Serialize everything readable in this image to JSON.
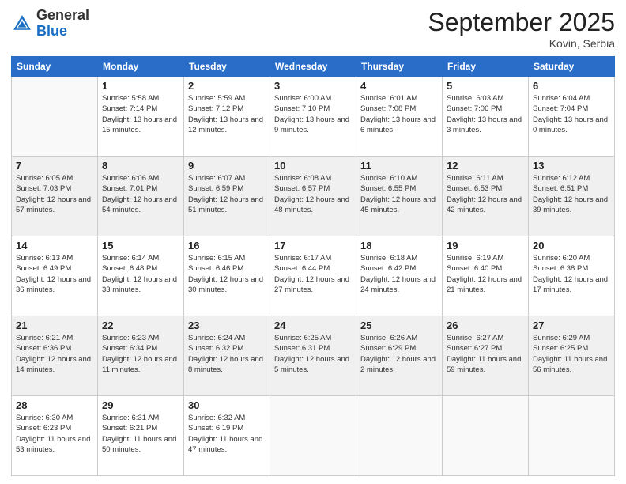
{
  "logo": {
    "general": "General",
    "blue": "Blue"
  },
  "header": {
    "month": "September 2025",
    "location": "Kovin, Serbia"
  },
  "weekdays": [
    "Sunday",
    "Monday",
    "Tuesday",
    "Wednesday",
    "Thursday",
    "Friday",
    "Saturday"
  ],
  "weeks": [
    [
      {
        "day": "",
        "sunrise": "",
        "sunset": "",
        "daylight": ""
      },
      {
        "day": "1",
        "sunrise": "Sunrise: 5:58 AM",
        "sunset": "Sunset: 7:14 PM",
        "daylight": "Daylight: 13 hours and 15 minutes."
      },
      {
        "day": "2",
        "sunrise": "Sunrise: 5:59 AM",
        "sunset": "Sunset: 7:12 PM",
        "daylight": "Daylight: 13 hours and 12 minutes."
      },
      {
        "day": "3",
        "sunrise": "Sunrise: 6:00 AM",
        "sunset": "Sunset: 7:10 PM",
        "daylight": "Daylight: 13 hours and 9 minutes."
      },
      {
        "day": "4",
        "sunrise": "Sunrise: 6:01 AM",
        "sunset": "Sunset: 7:08 PM",
        "daylight": "Daylight: 13 hours and 6 minutes."
      },
      {
        "day": "5",
        "sunrise": "Sunrise: 6:03 AM",
        "sunset": "Sunset: 7:06 PM",
        "daylight": "Daylight: 13 hours and 3 minutes."
      },
      {
        "day": "6",
        "sunrise": "Sunrise: 6:04 AM",
        "sunset": "Sunset: 7:04 PM",
        "daylight": "Daylight: 13 hours and 0 minutes."
      }
    ],
    [
      {
        "day": "7",
        "sunrise": "Sunrise: 6:05 AM",
        "sunset": "Sunset: 7:03 PM",
        "daylight": "Daylight: 12 hours and 57 minutes."
      },
      {
        "day": "8",
        "sunrise": "Sunrise: 6:06 AM",
        "sunset": "Sunset: 7:01 PM",
        "daylight": "Daylight: 12 hours and 54 minutes."
      },
      {
        "day": "9",
        "sunrise": "Sunrise: 6:07 AM",
        "sunset": "Sunset: 6:59 PM",
        "daylight": "Daylight: 12 hours and 51 minutes."
      },
      {
        "day": "10",
        "sunrise": "Sunrise: 6:08 AM",
        "sunset": "Sunset: 6:57 PM",
        "daylight": "Daylight: 12 hours and 48 minutes."
      },
      {
        "day": "11",
        "sunrise": "Sunrise: 6:10 AM",
        "sunset": "Sunset: 6:55 PM",
        "daylight": "Daylight: 12 hours and 45 minutes."
      },
      {
        "day": "12",
        "sunrise": "Sunrise: 6:11 AM",
        "sunset": "Sunset: 6:53 PM",
        "daylight": "Daylight: 12 hours and 42 minutes."
      },
      {
        "day": "13",
        "sunrise": "Sunrise: 6:12 AM",
        "sunset": "Sunset: 6:51 PM",
        "daylight": "Daylight: 12 hours and 39 minutes."
      }
    ],
    [
      {
        "day": "14",
        "sunrise": "Sunrise: 6:13 AM",
        "sunset": "Sunset: 6:49 PM",
        "daylight": "Daylight: 12 hours and 36 minutes."
      },
      {
        "day": "15",
        "sunrise": "Sunrise: 6:14 AM",
        "sunset": "Sunset: 6:48 PM",
        "daylight": "Daylight: 12 hours and 33 minutes."
      },
      {
        "day": "16",
        "sunrise": "Sunrise: 6:15 AM",
        "sunset": "Sunset: 6:46 PM",
        "daylight": "Daylight: 12 hours and 30 minutes."
      },
      {
        "day": "17",
        "sunrise": "Sunrise: 6:17 AM",
        "sunset": "Sunset: 6:44 PM",
        "daylight": "Daylight: 12 hours and 27 minutes."
      },
      {
        "day": "18",
        "sunrise": "Sunrise: 6:18 AM",
        "sunset": "Sunset: 6:42 PM",
        "daylight": "Daylight: 12 hours and 24 minutes."
      },
      {
        "day": "19",
        "sunrise": "Sunrise: 6:19 AM",
        "sunset": "Sunset: 6:40 PM",
        "daylight": "Daylight: 12 hours and 21 minutes."
      },
      {
        "day": "20",
        "sunrise": "Sunrise: 6:20 AM",
        "sunset": "Sunset: 6:38 PM",
        "daylight": "Daylight: 12 hours and 17 minutes."
      }
    ],
    [
      {
        "day": "21",
        "sunrise": "Sunrise: 6:21 AM",
        "sunset": "Sunset: 6:36 PM",
        "daylight": "Daylight: 12 hours and 14 minutes."
      },
      {
        "day": "22",
        "sunrise": "Sunrise: 6:23 AM",
        "sunset": "Sunset: 6:34 PM",
        "daylight": "Daylight: 12 hours and 11 minutes."
      },
      {
        "day": "23",
        "sunrise": "Sunrise: 6:24 AM",
        "sunset": "Sunset: 6:32 PM",
        "daylight": "Daylight: 12 hours and 8 minutes."
      },
      {
        "day": "24",
        "sunrise": "Sunrise: 6:25 AM",
        "sunset": "Sunset: 6:31 PM",
        "daylight": "Daylight: 12 hours and 5 minutes."
      },
      {
        "day": "25",
        "sunrise": "Sunrise: 6:26 AM",
        "sunset": "Sunset: 6:29 PM",
        "daylight": "Daylight: 12 hours and 2 minutes."
      },
      {
        "day": "26",
        "sunrise": "Sunrise: 6:27 AM",
        "sunset": "Sunset: 6:27 PM",
        "daylight": "Daylight: 11 hours and 59 minutes."
      },
      {
        "day": "27",
        "sunrise": "Sunrise: 6:29 AM",
        "sunset": "Sunset: 6:25 PM",
        "daylight": "Daylight: 11 hours and 56 minutes."
      }
    ],
    [
      {
        "day": "28",
        "sunrise": "Sunrise: 6:30 AM",
        "sunset": "Sunset: 6:23 PM",
        "daylight": "Daylight: 11 hours and 53 minutes."
      },
      {
        "day": "29",
        "sunrise": "Sunrise: 6:31 AM",
        "sunset": "Sunset: 6:21 PM",
        "daylight": "Daylight: 11 hours and 50 minutes."
      },
      {
        "day": "30",
        "sunrise": "Sunrise: 6:32 AM",
        "sunset": "Sunset: 6:19 PM",
        "daylight": "Daylight: 11 hours and 47 minutes."
      },
      {
        "day": "",
        "sunrise": "",
        "sunset": "",
        "daylight": ""
      },
      {
        "day": "",
        "sunrise": "",
        "sunset": "",
        "daylight": ""
      },
      {
        "day": "",
        "sunrise": "",
        "sunset": "",
        "daylight": ""
      },
      {
        "day": "",
        "sunrise": "",
        "sunset": "",
        "daylight": ""
      }
    ]
  ]
}
